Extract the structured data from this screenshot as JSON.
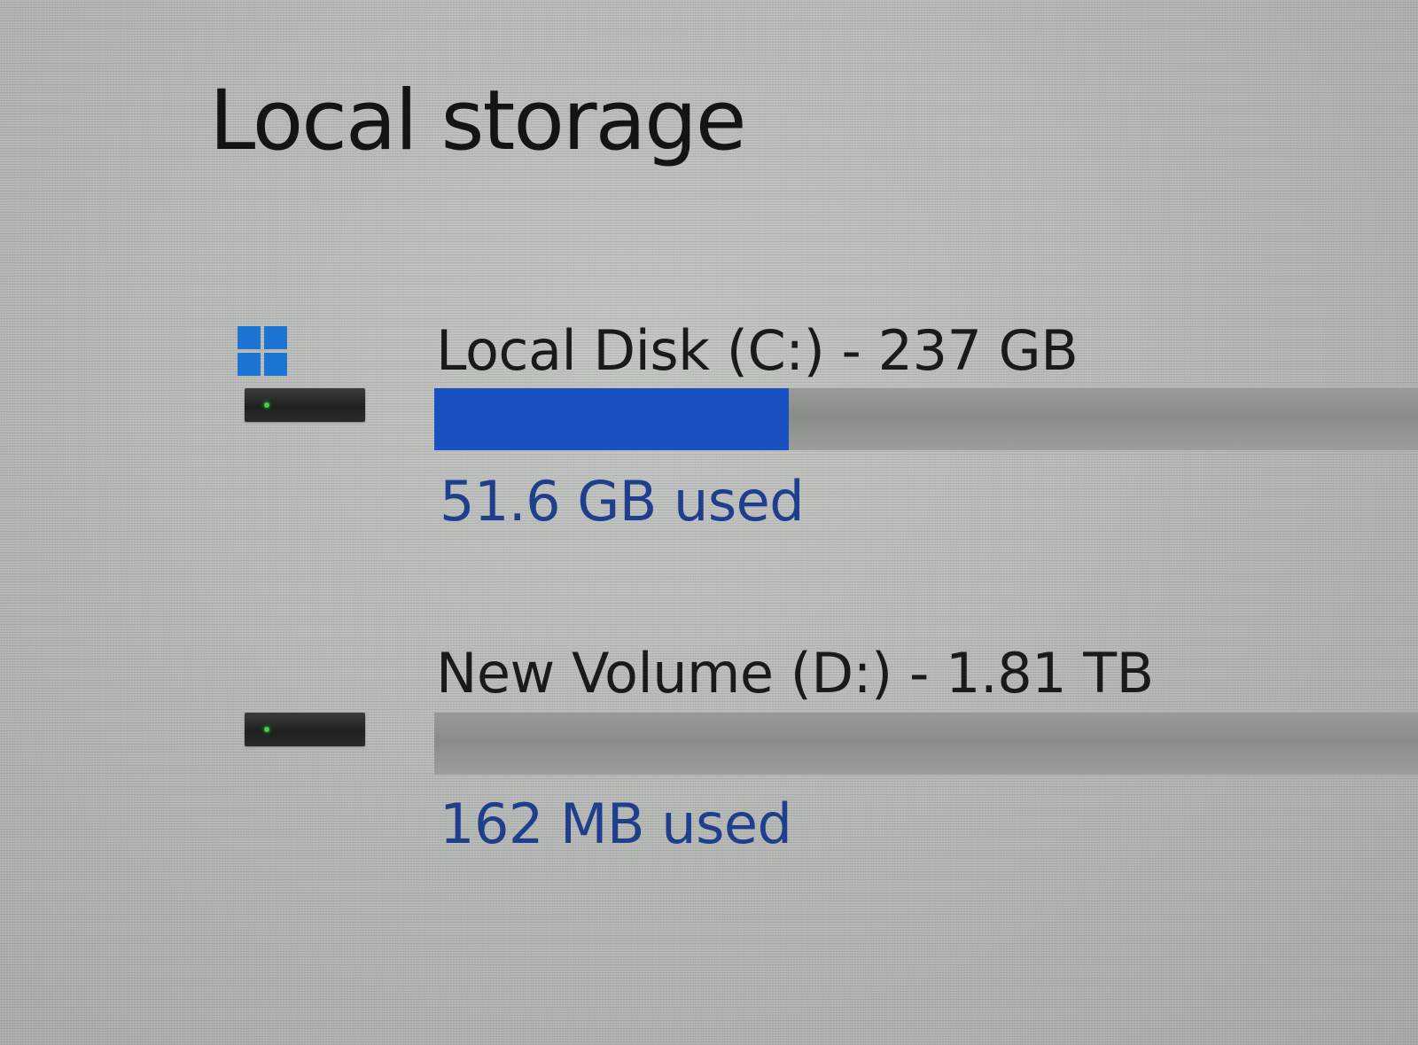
{
  "section": {
    "title": "Local storage"
  },
  "drives": [
    {
      "name": "Local Disk (C:) - 237 GB",
      "used_label": "51.6 GB used",
      "used_fraction": 0.36,
      "is_system_drive": true,
      "icon": "windows-logo-drive-icon"
    },
    {
      "name": "New Volume (D:) - 1.81 TB",
      "used_label": "162 MB used",
      "used_fraction": 0.0,
      "is_system_drive": false,
      "icon": "hard-drive-icon"
    }
  ],
  "colors": {
    "accent": "#1951c2",
    "used_text": "#1f3f8c",
    "bar_track": "#8f918f",
    "windows_logo": "#1b74d2"
  }
}
